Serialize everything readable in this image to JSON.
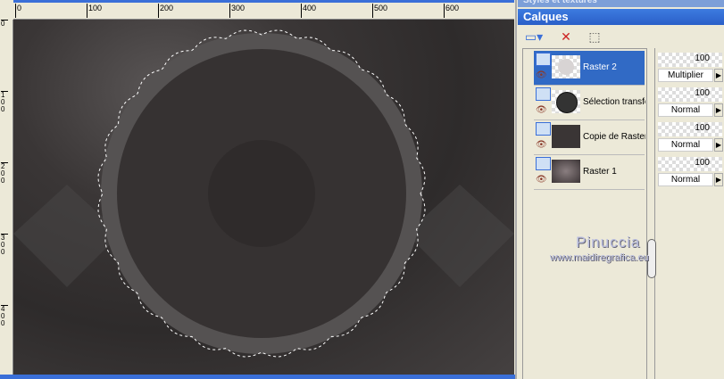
{
  "ruler": {
    "h": [
      "0",
      "100",
      "200",
      "300",
      "400",
      "500",
      "600"
    ],
    "v": [
      "0",
      "1 0 0",
      "2 0 0",
      "3 0 0",
      "4 0 0"
    ]
  },
  "panel": {
    "styles_title": "Styles et textures",
    "title": "Calques"
  },
  "toolbar": {
    "new_layer": "new-layer-icon",
    "delete": "delete-layer-icon",
    "mask": "edit-selection-icon"
  },
  "layers": [
    {
      "name": "Raster 2",
      "opacity": "100",
      "blend": "Multiplier",
      "selected": true
    },
    {
      "name": "Sélection transformée",
      "opacity": "100",
      "blend": "Normal"
    },
    {
      "name": "Copie de Raster",
      "opacity": "100",
      "blend": "Normal"
    },
    {
      "name": "Raster 1",
      "opacity": "100",
      "blend": "Normal"
    }
  ],
  "watermark": {
    "name": "Pinuccia",
    "url": "www.maidiregrafica.eu"
  }
}
